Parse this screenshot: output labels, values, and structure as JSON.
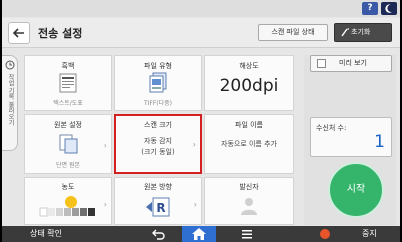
{
  "topbar": {
    "help_label": "?",
    "night_icon": "moon-icon"
  },
  "header": {
    "title": "전송 설정",
    "scan_status_label": "스캔 파일 상태",
    "reset_label": "초기화"
  },
  "side_tab": {
    "label": "작업 기록 불러오기"
  },
  "tiles": {
    "color": {
      "title": "흑백",
      "value": "텍스트/도표"
    },
    "filetype": {
      "title": "파일 유형",
      "value": "TIFF(다중)"
    },
    "resolution": {
      "title": "해상도",
      "value": "200dpi"
    },
    "original": {
      "title": "원본 설정",
      "value": "단면 원본"
    },
    "scansize": {
      "title": "스캔 크기",
      "value_line1": "자동 감지",
      "value_line2": "(크기 동일)"
    },
    "filename": {
      "title": "파일 이름",
      "value": "자동으로 이름 추가"
    },
    "density": {
      "title": "농도"
    },
    "orientation": {
      "title": "원본 방향"
    },
    "sender": {
      "title": "발신자"
    }
  },
  "right_panel": {
    "preview_label": "미리 보기",
    "copies_label": "수신처 수:",
    "copies_value": "1",
    "start_label": "시작"
  },
  "bottombar": {
    "status_label": "상태 확인",
    "stop_label": "중지"
  },
  "colors": {
    "start_green": "#34b56b",
    "highlight_red": "#d42020",
    "home_blue": "#2f6fd1",
    "copies_blue": "#1a62c4"
  }
}
